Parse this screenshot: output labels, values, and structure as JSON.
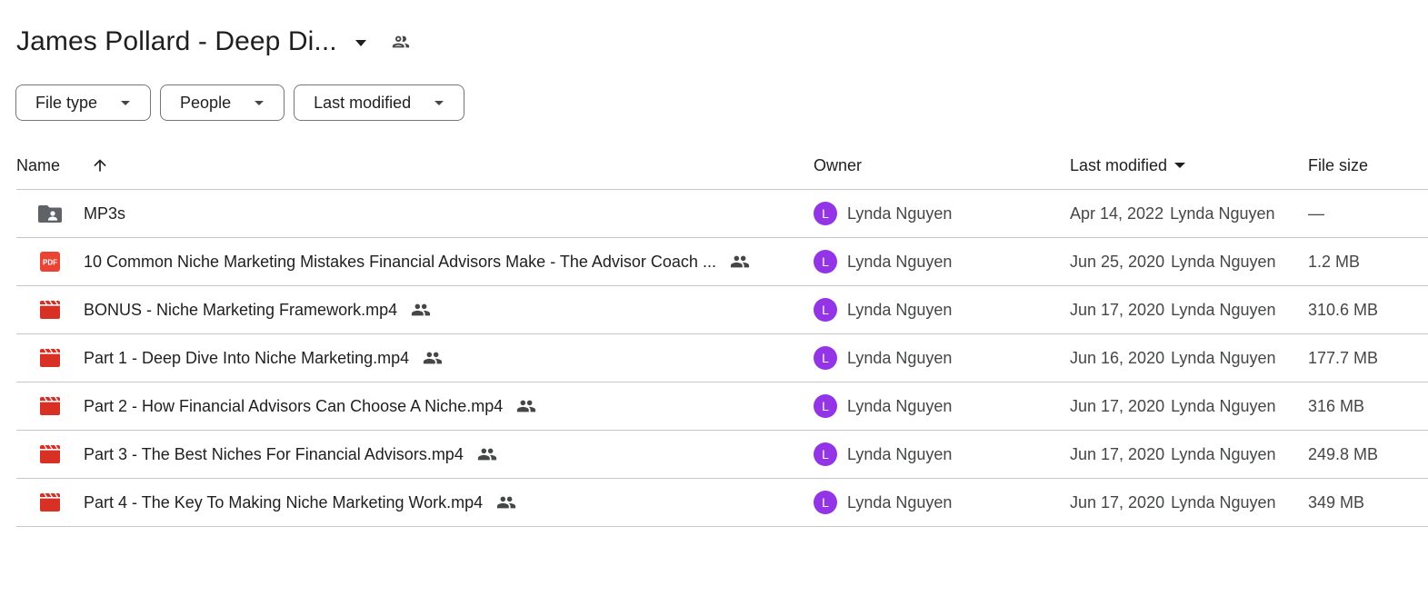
{
  "header": {
    "title": "James Pollard - Deep Di..."
  },
  "filters": [
    {
      "label": "File type"
    },
    {
      "label": "People"
    },
    {
      "label": "Last modified"
    }
  ],
  "columns": {
    "name": "Name",
    "owner": "Owner",
    "modified": "Last modified",
    "size": "File size"
  },
  "colors": {
    "avatar": "#9334e6",
    "pdf_red": "#ea4335",
    "video_red": "#d93025",
    "folder_gray": "#5f6368",
    "divider": "#c7c7c7"
  },
  "rows": [
    {
      "icon": "shared-folder-icon",
      "name": "MP3s",
      "shared": false,
      "avatar": "L",
      "owner": "Lynda Nguyen",
      "date": "Apr 14, 2022",
      "by": "Lynda Nguyen",
      "size": "—"
    },
    {
      "icon": "pdf-icon",
      "name": "10 Common Niche Marketing Mistakes Financial Advisors Make - The Advisor Coach ...",
      "shared": true,
      "avatar": "L",
      "owner": "Lynda Nguyen",
      "date": "Jun 25, 2020",
      "by": "Lynda Nguyen",
      "size": "1.2 MB"
    },
    {
      "icon": "video-icon",
      "name": "BONUS - Niche Marketing Framework.mp4",
      "shared": true,
      "avatar": "L",
      "owner": "Lynda Nguyen",
      "date": "Jun 17, 2020",
      "by": "Lynda Nguyen",
      "size": "310.6 MB"
    },
    {
      "icon": "video-icon",
      "name": "Part 1 - Deep Dive Into Niche Marketing.mp4",
      "shared": true,
      "avatar": "L",
      "owner": "Lynda Nguyen",
      "date": "Jun 16, 2020",
      "by": "Lynda Nguyen",
      "size": "177.7 MB"
    },
    {
      "icon": "video-icon",
      "name": "Part 2 - How Financial Advisors Can Choose A Niche.mp4",
      "shared": true,
      "avatar": "L",
      "owner": "Lynda Nguyen",
      "date": "Jun 17, 2020",
      "by": "Lynda Nguyen",
      "size": "316 MB"
    },
    {
      "icon": "video-icon",
      "name": "Part 3 - The Best Niches For Financial Advisors.mp4",
      "shared": true,
      "avatar": "L",
      "owner": "Lynda Nguyen",
      "date": "Jun 17, 2020",
      "by": "Lynda Nguyen",
      "size": "249.8 MB"
    },
    {
      "icon": "video-icon",
      "name": "Part 4 - The Key To Making Niche Marketing Work.mp4",
      "shared": true,
      "avatar": "L",
      "owner": "Lynda Nguyen",
      "date": "Jun 17, 2020",
      "by": "Lynda Nguyen",
      "size": "349 MB"
    }
  ]
}
